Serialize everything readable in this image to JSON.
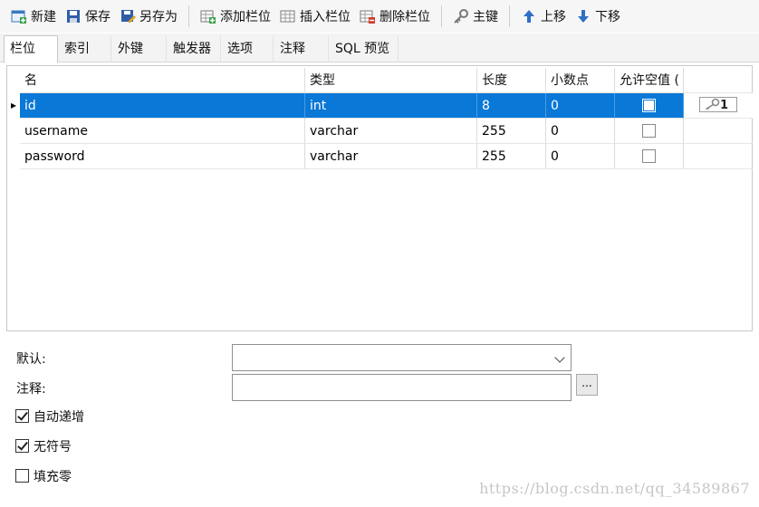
{
  "toolbar": {
    "new": "新建",
    "save": "保存",
    "save_as": "另存为",
    "add_column": "添加栏位",
    "insert_column": "插入栏位",
    "delete_column": "删除栏位",
    "primary_key": "主键",
    "move_up": "上移",
    "move_down": "下移"
  },
  "tabs": [
    "栏位",
    "索引",
    "外键",
    "触发器",
    "选项",
    "注释",
    "SQL 预览"
  ],
  "grid": {
    "headers": [
      "名",
      "类型",
      "长度",
      "小数点",
      "允许空值 ("
    ],
    "rows": [
      {
        "name": "id",
        "type": "int",
        "length": "8",
        "decimals": "0",
        "not_null": true,
        "key": "1"
      },
      {
        "name": "username",
        "type": "varchar",
        "length": "255",
        "decimals": "0",
        "not_null": false,
        "key": ""
      },
      {
        "name": "password",
        "type": "varchar",
        "length": "255",
        "decimals": "0",
        "not_null": false,
        "key": ""
      }
    ]
  },
  "form": {
    "default_label": "默认:",
    "comment_label": "注释:",
    "dots": "...",
    "auto_increment": {
      "label": "自动递增",
      "checked": true
    },
    "unsigned": {
      "label": "无符号",
      "checked": true
    },
    "zerofill": {
      "label": "填充零",
      "checked": false
    }
  },
  "watermark": "https://blog.csdn.net/qq_34589867"
}
